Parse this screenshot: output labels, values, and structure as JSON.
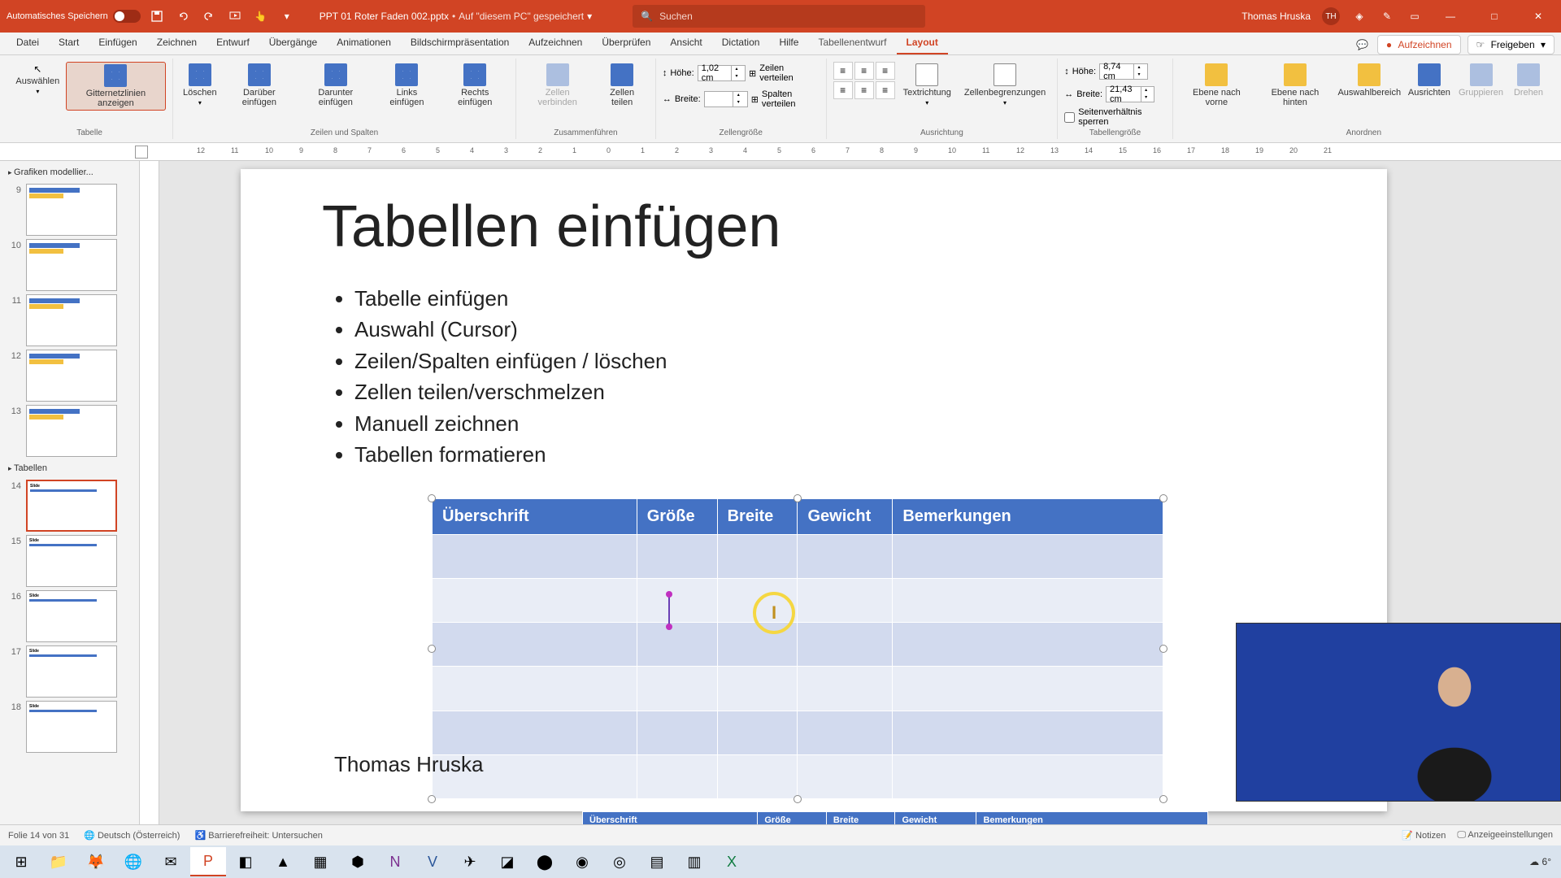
{
  "titlebar": {
    "autosave": "Automatisches Speichern",
    "filename": "PPT 01 Roter Faden 002.pptx",
    "savedloc": "Auf \"diesem PC\" gespeichert",
    "search_placeholder": "Suchen",
    "user": "Thomas Hruska",
    "initials": "TH"
  },
  "tabs": {
    "items": [
      "Datei",
      "Start",
      "Einfügen",
      "Zeichnen",
      "Entwurf",
      "Übergänge",
      "Animationen",
      "Bildschirmpräsentation",
      "Aufzeichnen",
      "Überprüfen",
      "Ansicht",
      "Dictation",
      "Hilfe",
      "Tabellenentwurf",
      "Layout"
    ],
    "active": "Layout",
    "context_start": 13,
    "record": "Aufzeichnen",
    "share": "Freigeben"
  },
  "ribbon": {
    "g_tabelle": "Tabelle",
    "auswaehlen": "Auswählen",
    "gitter": "Gitternetzlinien anzeigen",
    "loeschen": "Löschen",
    "g_zeilen": "Zeilen und Spalten",
    "darueber": "Darüber einfügen",
    "darunter": "Darunter einfügen",
    "links": "Links einfügen",
    "rechts": "Rechts einfügen",
    "g_zusammen": "Zusammenführen",
    "verbinden": "Zellen verbinden",
    "teilen": "Zellen teilen",
    "g_zellen": "Zellengröße",
    "hoehe": "Höhe:",
    "breite": "Breite:",
    "h_val": "1,02 cm",
    "b_val": "",
    "zeilen_vert": "Zeilen verteilen",
    "spalten_vert": "Spalten verteilen",
    "g_ausrichtung": "Ausrichtung",
    "textrichtung": "Textrichtung",
    "zellenbegr": "Zellenbegrenzungen",
    "g_tabgroesse": "Tabellengröße",
    "tab_h": "8,74 cm",
    "tab_b": "21,43 cm",
    "seitenverh": "Seitenverhältnis sperren",
    "g_anordnen": "Anordnen",
    "vorne": "Ebene nach vorne",
    "hinten": "Ebene nach hinten",
    "auswahlbereich": "Auswahlbereich",
    "ausrichten": "Ausrichten",
    "gruppieren": "Gruppieren",
    "drehen": "Drehen"
  },
  "ruler": {
    "ticks": [
      "12",
      "11",
      "10",
      "9",
      "8",
      "7",
      "6",
      "5",
      "4",
      "3",
      "2",
      "1",
      "0",
      "1",
      "2",
      "3",
      "4",
      "5",
      "6",
      "7",
      "8",
      "9",
      "10",
      "11",
      "12",
      "13",
      "14",
      "15",
      "16",
      "17",
      "18",
      "19",
      "20",
      "21"
    ]
  },
  "sections": {
    "grafiken": "Grafiken modellier...",
    "tabellen": "Tabellen"
  },
  "thumbs": [
    9,
    10,
    11,
    12,
    13,
    14,
    15,
    16,
    17,
    18
  ],
  "current_slide": 14,
  "slide": {
    "title": "Tabellen einfügen",
    "bullets": [
      "Tabelle einfügen",
      "Auswahl (Cursor)",
      "Zeilen/Spalten einfügen / löschen",
      "Zellen teilen/verschmelzen",
      "Manuell zeichnen",
      "Tabellen formatieren"
    ],
    "headers": [
      "Überschrift",
      "Größe",
      "Breite",
      "Gewicht",
      "Bemerkungen"
    ],
    "author": "Thomas Hruska",
    "highlight_char": "I"
  },
  "status": {
    "slide": "Folie 14 von 31",
    "lang": "Deutsch (Österreich)",
    "access": "Barrierefreiheit: Untersuchen",
    "notes": "Notizen",
    "display": "Anzeigeeinstellungen"
  },
  "taskbar": {
    "temp": "6°"
  }
}
